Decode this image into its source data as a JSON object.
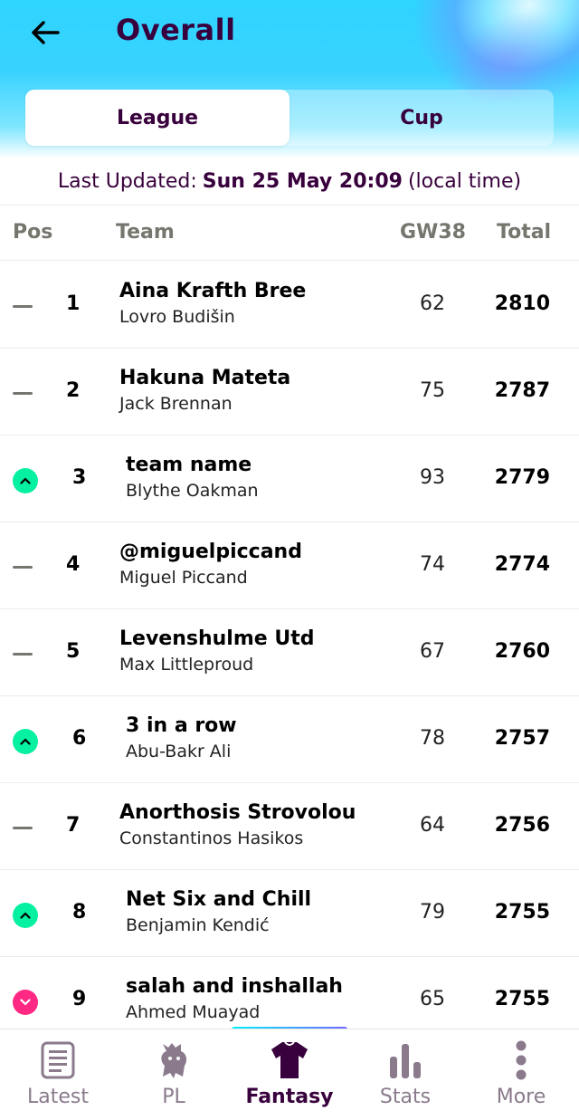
{
  "header": {
    "title": "Overall",
    "back_icon": "arrow-left-icon"
  },
  "tabs": [
    {
      "label": "League",
      "active": true
    },
    {
      "label": "Cup",
      "active": false
    }
  ],
  "last_updated": {
    "prefix": "Last Updated:",
    "datetime": "Sun 25 May 20:09",
    "suffix": "(local time)"
  },
  "columns": {
    "pos": "Pos",
    "team": "Team",
    "gw": "GW38",
    "total": "Total"
  },
  "rows": [
    {
      "movement": "same",
      "rank": "1",
      "team": "Aina Krafth Bree",
      "manager": "Lovro Budišin",
      "gw": "62",
      "total": "2810"
    },
    {
      "movement": "same",
      "rank": "2",
      "team": "Hakuna Mateta",
      "manager": "Jack Brennan",
      "gw": "75",
      "total": "2787"
    },
    {
      "movement": "up",
      "rank": "3",
      "team": "team name",
      "manager": "Blythe Oakman",
      "gw": "93",
      "total": "2779"
    },
    {
      "movement": "same",
      "rank": "4",
      "team": "@miguelpiccand",
      "manager": "Miguel Piccand",
      "gw": "74",
      "total": "2774"
    },
    {
      "movement": "same",
      "rank": "5",
      "team": "Levenshulme Utd",
      "manager": "Max Littleproud",
      "gw": "67",
      "total": "2760"
    },
    {
      "movement": "up",
      "rank": "6",
      "team": "3 in a row",
      "manager": "Abu-Bakr Ali",
      "gw": "78",
      "total": "2757"
    },
    {
      "movement": "same",
      "rank": "7",
      "team": "Anorthosis Strovolou",
      "manager": "Constantinos Hasikos",
      "gw": "64",
      "total": "2756"
    },
    {
      "movement": "up",
      "rank": "8",
      "team": "Net Six and Chill",
      "manager": "Benjamin Kendić",
      "gw": "79",
      "total": "2755"
    },
    {
      "movement": "down",
      "rank": "9",
      "team": "salah and inshallah",
      "manager": "Ahmed Muayad",
      "gw": "65",
      "total": "2755"
    }
  ],
  "nav": [
    {
      "label": "Latest",
      "icon": "news-icon",
      "active": false
    },
    {
      "label": "PL",
      "icon": "lion-icon",
      "active": false
    },
    {
      "label": "Fantasy",
      "icon": "shirt-icon",
      "active": true
    },
    {
      "label": "Stats",
      "icon": "bar-chart-icon",
      "active": false
    },
    {
      "label": "More",
      "icon": "more-dots-icon",
      "active": false
    }
  ],
  "colors": {
    "brand_purple": "#38003c",
    "header_cyan": "#2ed5ff",
    "up_green": "#05f0a0",
    "down_pink": "#ff2882"
  }
}
